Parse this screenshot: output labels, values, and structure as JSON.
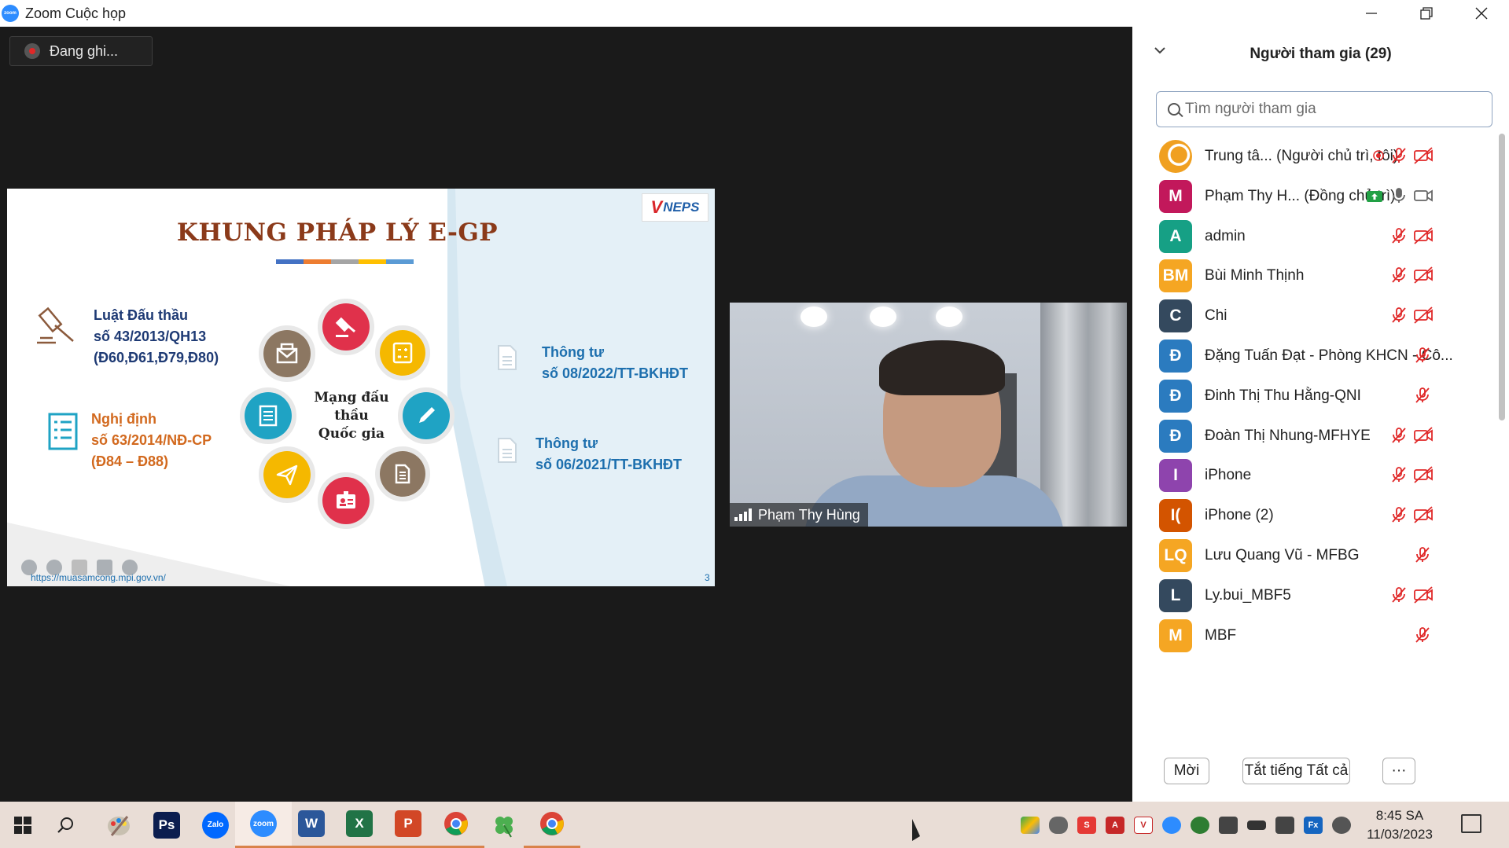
{
  "window": {
    "app_icon": "zoom",
    "title": "Zoom Cuộc họp",
    "controls": [
      "minimize-icon",
      "restore-icon",
      "close-icon"
    ]
  },
  "recording": {
    "label": "Đang ghi..."
  },
  "slide": {
    "title": "KHUNG PHÁP LÝ E-GP",
    "logo_text": "NEPS",
    "law": [
      "Luật Đấu thầu",
      "số 43/2013/QH13",
      "(Đ60,Đ61,Đ79,Đ80)"
    ],
    "decree": [
      "Nghị định",
      "số 63/2014/NĐ-CP",
      "(Đ84 – Đ88)"
    ],
    "center": [
      "Mạng đấu thầu",
      "Quốc gia"
    ],
    "circular1": [
      "Thông tư",
      "số 08/2022/TT-BKHĐT"
    ],
    "circular2": [
      "Thông tư",
      "số 06/2021/TT-BKHĐT"
    ],
    "url": "https://muasamcong.mpi.gov.vn/",
    "page": "3",
    "bar_colors": [
      "#4472c4",
      "#ed7d31",
      "#a5a5a5",
      "#ffc000",
      "#5b9bd5"
    ]
  },
  "video": {
    "name": "Phạm Thy Hùng"
  },
  "panel": {
    "title": "Người tham gia (29)",
    "search_placeholder": "Tìm người tham gia",
    "participants": [
      {
        "initials": "",
        "name": "Trung tâ... (Người chủ trì, tôi)",
        "color": "#ffffff",
        "rec": true,
        "mic": "muted",
        "cam": "off",
        "logo": true
      },
      {
        "initials": "M",
        "name": "Phạm Thy H...  (Đồng chủ trì)",
        "color": "#c2185b",
        "share": true,
        "mic": "on",
        "cam": "on"
      },
      {
        "initials": "A",
        "name": "admin",
        "color": "#16a085",
        "mic": "muted",
        "cam": "off"
      },
      {
        "initials": "BM",
        "name": "Bùi Minh Thịnh",
        "color": "#f5a623",
        "mic": "muted",
        "cam": "off"
      },
      {
        "initials": "C",
        "name": "Chi",
        "color": "#34495e",
        "mic": "muted",
        "cam": "off"
      },
      {
        "initials": "Đ",
        "name": "Đặng Tuấn Đạt - Phòng KHCN - Cô...",
        "color": "#2b7bbf",
        "mic": "muted",
        "cam": "none"
      },
      {
        "initials": "Đ",
        "name": "Đinh Thị Thu Hằng-QNI",
        "color": "#2b7bbf",
        "mic": "muted",
        "cam": "none"
      },
      {
        "initials": "Đ",
        "name": "Đoàn Thị Nhung-MFHYE",
        "color": "#2b7bbf",
        "mic": "muted",
        "cam": "off"
      },
      {
        "initials": "I",
        "name": "iPhone",
        "color": "#8e44ad",
        "mic": "muted",
        "cam": "off"
      },
      {
        "initials": "I(",
        "name": "iPhone (2)",
        "color": "#d35400",
        "mic": "muted",
        "cam": "off"
      },
      {
        "initials": "LQ",
        "name": "Lưu Quang Vũ - MFBG",
        "color": "#f5a623",
        "mic": "muted",
        "cam": "none"
      },
      {
        "initials": "L",
        "name": "Ly.bui_MBF5",
        "color": "#34495e",
        "mic": "muted",
        "cam": "off"
      },
      {
        "initials": "M",
        "name": "MBF",
        "color": "#f5a623",
        "mic": "muted",
        "cam": "none"
      }
    ],
    "footer": {
      "invite": "Mời",
      "mute_all": "Tắt tiếng Tất cả",
      "more": "···"
    }
  },
  "taskbar": {
    "apps": [
      {
        "name": "windows-start",
        "label": ""
      },
      {
        "name": "search",
        "label": ""
      },
      {
        "name": "paint",
        "label": ""
      },
      {
        "name": "photoshop",
        "label": "Ps",
        "color": "#0b1d4f"
      },
      {
        "name": "zalo",
        "label": "Zalo",
        "color": "#0068ff"
      },
      {
        "name": "zoom",
        "label": "zoom",
        "color": "#2d8cff"
      },
      {
        "name": "word",
        "label": "W",
        "color": "#2b579a"
      },
      {
        "name": "excel",
        "label": "X",
        "color": "#217346"
      },
      {
        "name": "powerpoint",
        "label": "P",
        "color": "#d24726"
      },
      {
        "name": "chrome",
        "label": ""
      },
      {
        "name": "clover",
        "label": ""
      },
      {
        "name": "chrome-2",
        "label": ""
      }
    ],
    "time": "8:45 SA",
    "date": "11/03/2023"
  }
}
